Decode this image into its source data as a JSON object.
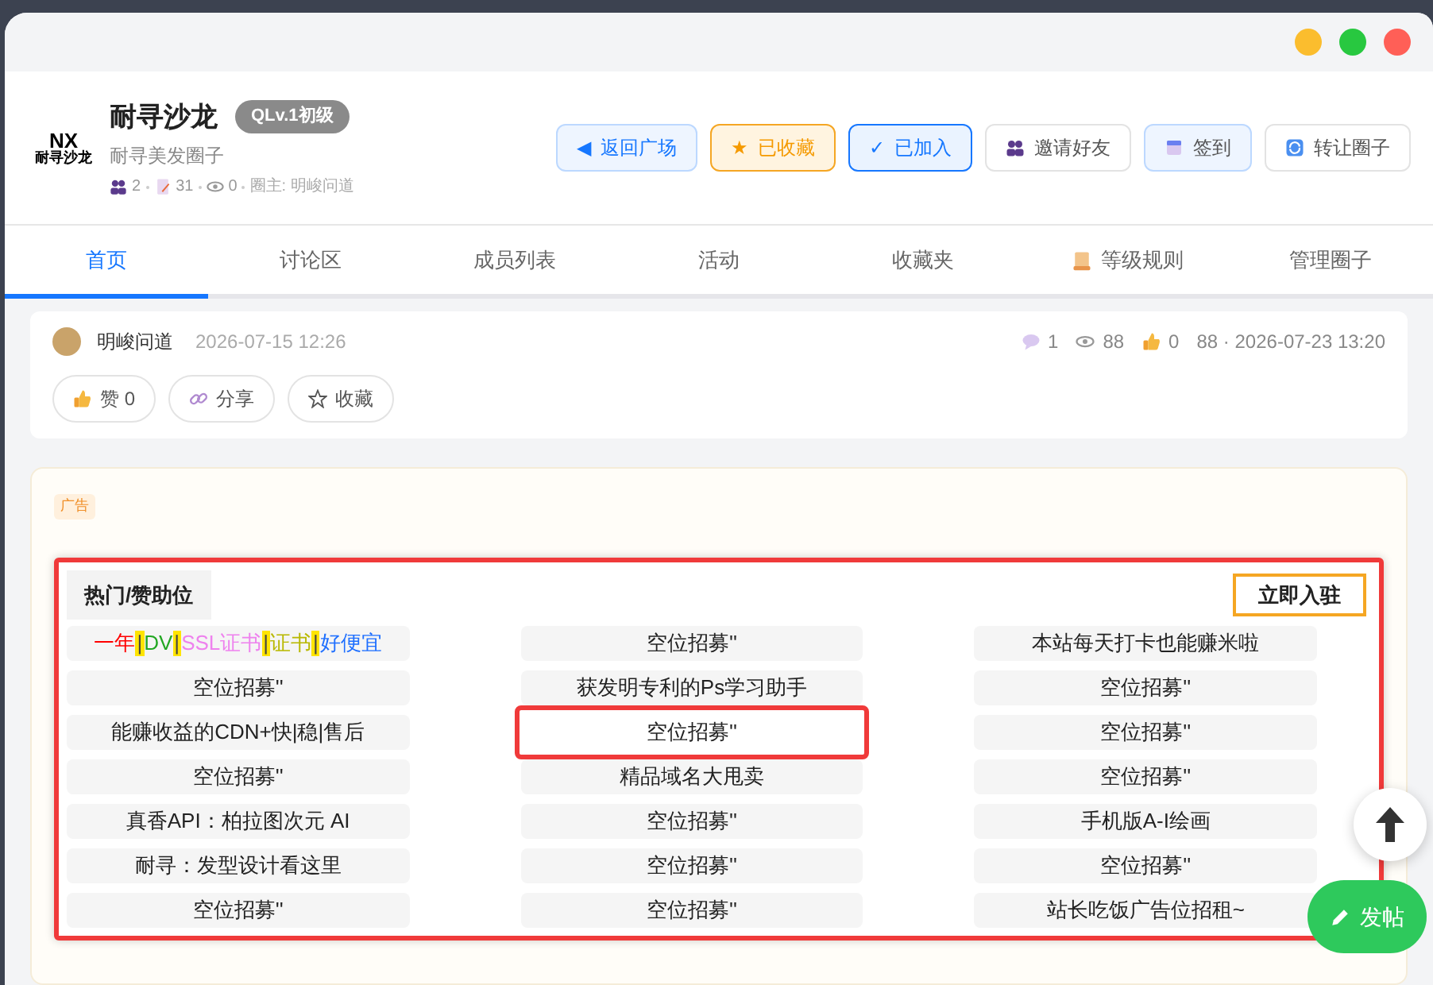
{
  "circle": {
    "logo_text": "NX",
    "logo_caption": "耐寻沙龙",
    "name": "耐寻沙龙",
    "level_badge": "QLv.1初级",
    "subtitle": "耐寻美发圈子",
    "stats": [
      {
        "kind": "members",
        "value": "2"
      },
      {
        "kind": "posts",
        "value": "31"
      },
      {
        "kind": "views",
        "value": "0"
      }
    ],
    "owner": "圈主: 明峻问道"
  },
  "actions": [
    {
      "kind": "back",
      "glyph": "◀",
      "label": "返回广场"
    },
    {
      "kind": "favorited",
      "glyph": "★",
      "label": "已收藏"
    },
    {
      "kind": "joined",
      "glyph": "✓",
      "label": "已加入"
    },
    {
      "kind": "invite",
      "label": "邀请好友"
    },
    {
      "kind": "checkin",
      "label": "签到"
    },
    {
      "kind": "transfer",
      "label": "转让圈子"
    }
  ],
  "tabs": [
    {
      "kind": "text",
      "label": "首页",
      "selected": true
    },
    {
      "kind": "text",
      "label": "讨论区",
      "selected": false
    },
    {
      "kind": "text",
      "label": "成员列表",
      "selected": false
    },
    {
      "kind": "text",
      "label": "活动",
      "selected": false
    },
    {
      "kind": "text",
      "label": "收藏夹",
      "selected": false
    },
    {
      "kind": "rules",
      "label": "等级规则",
      "selected": false
    },
    {
      "kind": "text",
      "label": "管理圈子",
      "selected": false
    }
  ],
  "post": {
    "author": "明峻问道",
    "date": "2026-07-15 12:26",
    "comments": "1",
    "views": "88",
    "likes": "0",
    "last_reply": "88 · 2026-07-23 13:20",
    "buttons": [
      {
        "kind": "like",
        "label": "赞 0"
      },
      {
        "kind": "share",
        "label": "分享"
      },
      {
        "kind": "favorite",
        "label": "收藏"
      }
    ]
  },
  "ad": {
    "tag": "广告",
    "title": "热门/赞助位",
    "join_button": "立即入驻",
    "cells": [
      {
        "segments": [
          {
            "kind": "text",
            "text": "一年",
            "color": "#ff0000"
          },
          {
            "kind": "separator",
            "text": "|",
            "color": "#ffe400"
          },
          {
            "kind": "text",
            "text": "DV",
            "color": "#22a722"
          },
          {
            "kind": "separator",
            "text": "|",
            "color": "#ffe400"
          },
          {
            "kind": "text",
            "text": "SSL证书",
            "color": "#ee82ee"
          },
          {
            "kind": "separator",
            "text": "|",
            "color": "#ffe400"
          },
          {
            "kind": "text",
            "text": "证书",
            "color": "#b8b800"
          },
          {
            "kind": "separator",
            "text": "|",
            "color": "#ffe400"
          },
          {
            "kind": "text",
            "text": "好便宜",
            "color": "#1e6fff"
          }
        ],
        "selected": false
      },
      {
        "text": "空位招募''",
        "selected": false
      },
      {
        "text": "本站每天打卡也能赚米啦",
        "selected": false
      },
      {
        "text": "空位招募''",
        "selected": false
      },
      {
        "text": "获发明专利的Ps学习助手",
        "selected": false
      },
      {
        "text": "空位招募''",
        "selected": false
      },
      {
        "text": "能赚收益的CDN+快|稳|售后",
        "selected": false
      },
      {
        "text": "空位招募''",
        "selected": true
      },
      {
        "text": "空位招募''",
        "selected": false
      },
      {
        "text": "空位招募''",
        "selected": false
      },
      {
        "text": "精品域名大甩卖",
        "selected": false
      },
      {
        "text": "空位招募''",
        "selected": false
      },
      {
        "text": "真香API：柏拉图次元 AI",
        "selected": false
      },
      {
        "text": "空位招募''",
        "selected": false
      },
      {
        "text": "手机版A-I绘画",
        "selected": false
      },
      {
        "text": "耐寻：发型设计看这里",
        "selected": false
      },
      {
        "text": "空位招募''",
        "selected": false
      },
      {
        "text": "空位招募''",
        "selected": false
      },
      {
        "text": "空位招募''",
        "selected": false
      },
      {
        "text": "空位招募''",
        "selected": false
      },
      {
        "text": "站长吃饭广告位招租~",
        "selected": false
      }
    ]
  },
  "fab": {
    "post_button": "发帖"
  }
}
